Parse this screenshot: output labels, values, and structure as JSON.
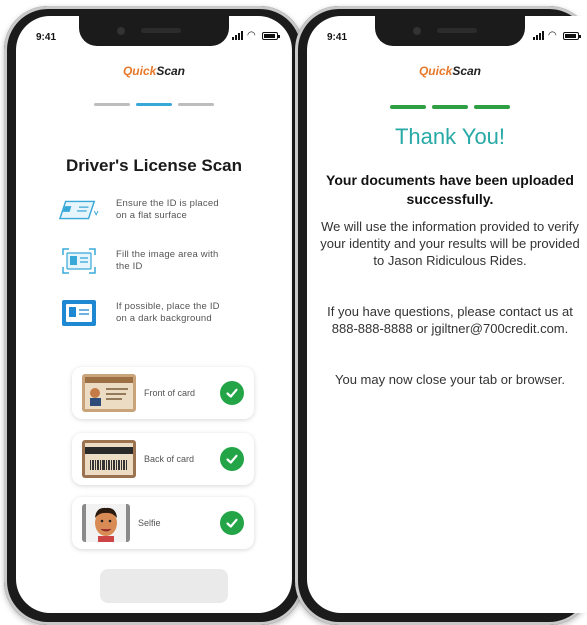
{
  "colors": {
    "brand_orange": "#e8792a",
    "step_inactive": "#bdbdbd",
    "step_active": "#38a8d8",
    "step_done": "#2ea043",
    "check_green": "#22a447",
    "thank_you_teal": "#27a9a6"
  },
  "status_bar": {
    "time": "9:41"
  },
  "brand": {
    "part1": "Quick",
    "part2": "Scan"
  },
  "left_screen": {
    "title": "Driver's License Scan",
    "tips": [
      {
        "icon": "id-flat-surface-icon",
        "text": "Ensure the ID is placed on a flat surface"
      },
      {
        "icon": "id-frame-icon",
        "text": "Fill the image area with the ID"
      },
      {
        "icon": "id-dark-background-icon",
        "text": "If possible, place the ID on a dark background"
      }
    ],
    "cards": [
      {
        "label": "Front of card",
        "status_icon": "check-icon"
      },
      {
        "label": "Back of card",
        "status_icon": "check-icon"
      },
      {
        "label": "Selfie",
        "status_icon": "check-icon"
      }
    ]
  },
  "right_screen": {
    "title": "Thank You!",
    "headline": "Your documents have been uploaded successfully.",
    "para1": "We will use the information provided to verify your identity and your results will be provided to Jason Ridiculous Rides.",
    "para2": "If you have questions, please contact us at 888-888-8888 or jgiltner@700credit.com.",
    "para3": "You may now close your tab or browser."
  }
}
